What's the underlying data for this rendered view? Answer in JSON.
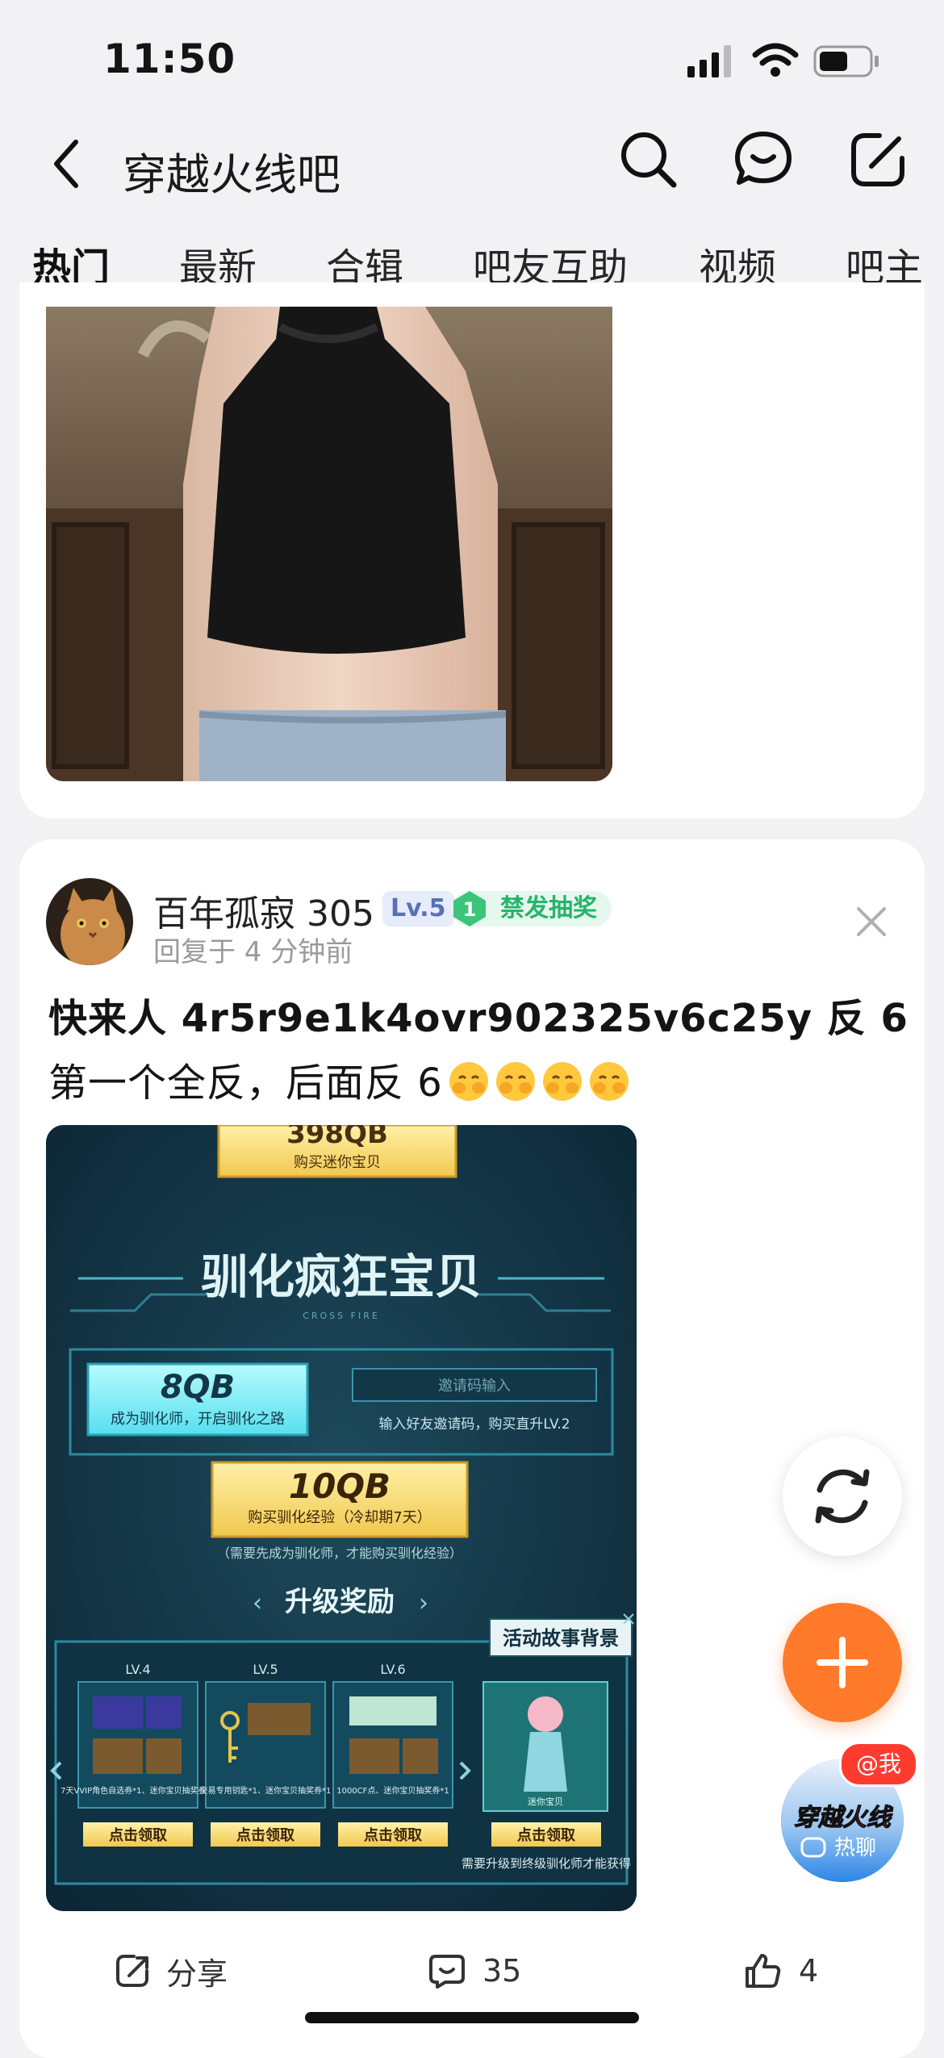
{
  "status_bar": {
    "time": "11:50"
  },
  "header": {
    "title": "穿越火线吧"
  },
  "tabs": [
    {
      "label": "热门",
      "active": true
    },
    {
      "label": "最新"
    },
    {
      "label": "合辑"
    },
    {
      "label": "吧友互助"
    },
    {
      "label": "视频"
    },
    {
      "label": "吧主"
    }
  ],
  "post": {
    "username": "百年孤寂 305",
    "level": "Lv.5",
    "tag_number": "1",
    "tag": "禁发抽奖",
    "reply_time": "回复于 4 分钟前",
    "line1": "快来人  4r5r9e1k4ovr902325v6c25y  反 6",
    "line2": "第一个全反，后面反 6",
    "promo": {
      "top_price": "398QB",
      "top_caption": "购买迷你宝贝",
      "headline": "驯化疯狂宝贝",
      "subtitle": "CROSS FIRE",
      "price1": "8QB",
      "price1_caption": "成为驯化师，开启驯化之路",
      "invite_placeholder": "邀请码输入",
      "invite_caption": "输入好友邀请码，购买直升LV.2",
      "price2": "10QB",
      "price2_caption": "购买驯化经验（冷却期7天）",
      "note": "（需要先成为驯化师，才能购买驯化经验）",
      "rewards_title": "升级奖励",
      "story_label": "活动故事背景",
      "levels": [
        {
          "level": "LV.4",
          "desc": "7天VVIP角色自选券*1、迷你宝贝抽奖券*1"
        },
        {
          "level": "LV.5",
          "desc": "交易专用钥匙*1、迷你宝贝抽奖券*1"
        },
        {
          "level": "LV.6",
          "desc": "1000CF点、迷你宝贝抽奖券*1"
        }
      ],
      "claim_label": "点击领取",
      "final_caption": "需要升级到终级驯化师才能获得",
      "final_name": "迷你宝贝"
    }
  },
  "actions": {
    "share": "分享",
    "comments": "35",
    "likes": "4"
  },
  "chat_widget": {
    "badge": "@我",
    "label": "热聊",
    "logo": "穿越火线"
  },
  "colors": {
    "accent": "#ff6a1a",
    "tag_green": "#27b36a",
    "level_blue": "#5a6fb8",
    "fab_orange": "#ff7a2a"
  }
}
